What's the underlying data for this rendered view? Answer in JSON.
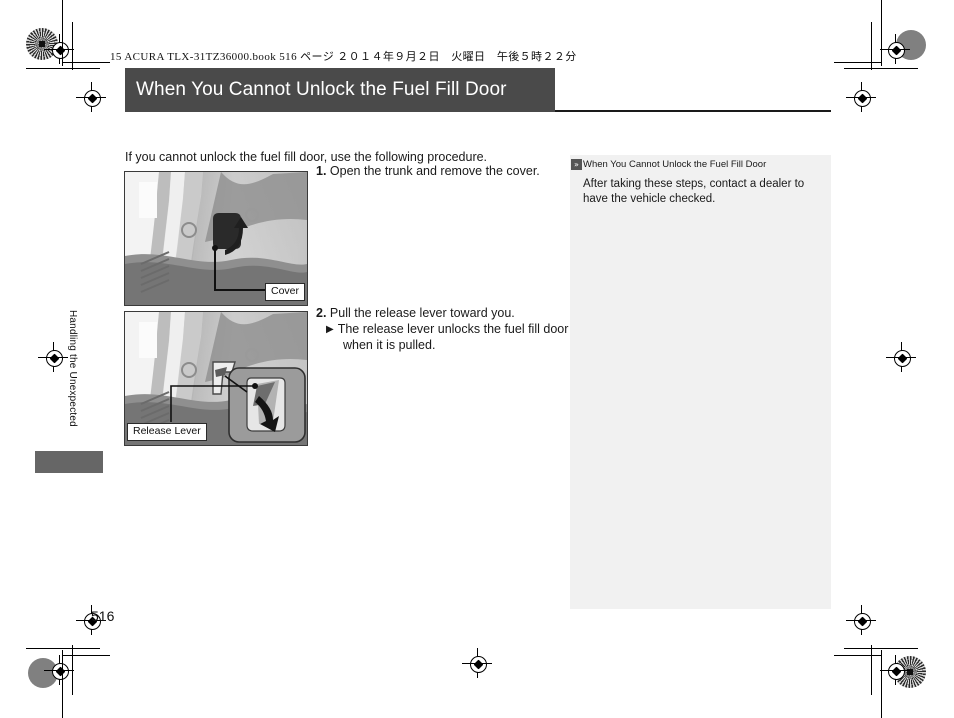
{
  "print_header": {
    "book_line": "15 ACURA TLX-31TZ36000.book   516 ページ   ２０１４年９月２日　火曜日　午後５時２２分"
  },
  "page": {
    "title": "When You Cannot Unlock the Fuel Fill Door",
    "number": "516",
    "section_tab": "Handling the Unexpected",
    "intro": "If you cannot unlock the fuel fill door, use the following procedure."
  },
  "steps": [
    {
      "num": "1.",
      "text": "Open the trunk and remove the cover."
    },
    {
      "num": "2.",
      "text": "Pull the release lever toward you."
    }
  ],
  "substep": {
    "marker": "▶",
    "line1": "The release lever unlocks the fuel fill door",
    "line2": "when it is pulled."
  },
  "figures": [
    {
      "caption": "Cover"
    },
    {
      "caption": "Release Lever"
    }
  ],
  "sidenote": {
    "marker_icon": "double-chevron-icon",
    "marker": "»",
    "heading": "When You Cannot Unlock the Fuel Fill Door",
    "body": "After taking these steps, contact a dealer to have the vehicle checked."
  },
  "colors": {
    "title_band": "#4a4a4a",
    "sidenote_bg": "#f1f1f1",
    "tab_block": "#666666",
    "text": "#1a1a1a"
  }
}
